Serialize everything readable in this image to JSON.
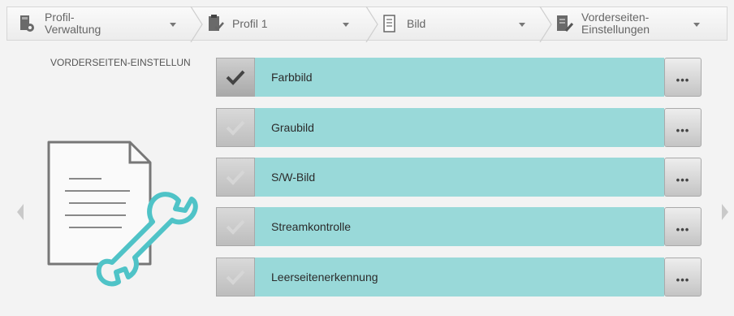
{
  "breadcrumb": [
    {
      "label": "Profil-\nVerwaltung",
      "icon": "profile-gear-icon"
    },
    {
      "label": "Profil 1",
      "icon": "clipboard-check-icon"
    },
    {
      "label": "Bild",
      "icon": "document-icon"
    },
    {
      "label": "Vorderseiten-\nEinstellungen",
      "icon": "document-edit-icon"
    }
  ],
  "panel": {
    "title": "VORDERSEITEN-EINSTELLUN",
    "illustration": "document-wrench-icon"
  },
  "options": [
    {
      "label": "Farbbild",
      "checked": true,
      "more": "•••"
    },
    {
      "label": "Graubild",
      "checked": false,
      "more": "•••"
    },
    {
      "label": "S/W-Bild",
      "checked": false,
      "more": "•••"
    },
    {
      "label": "Streamkontrolle",
      "checked": false,
      "more": "•••"
    },
    {
      "label": "Leerseitenerkennung",
      "checked": false,
      "more": "•••"
    }
  ],
  "colors": {
    "accent": "#99d9d9",
    "wrench": "#4fc3c7"
  }
}
